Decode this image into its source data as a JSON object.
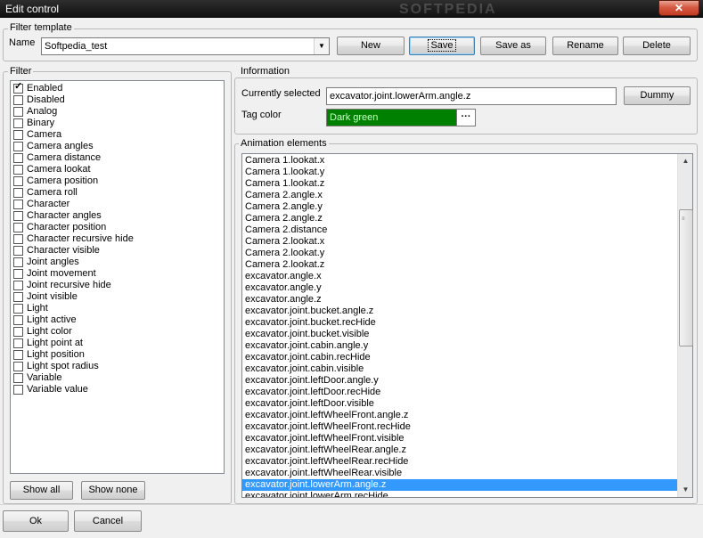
{
  "window": {
    "title": "Edit control",
    "close_glyph": "✕",
    "watermark": "SOFTPEDIA"
  },
  "filter_template": {
    "group_label": "Filter template",
    "name_label": "Name",
    "name_value": "Softpedia_test",
    "buttons": {
      "new": "New",
      "save": "Save",
      "save_as": "Save as",
      "rename": "Rename",
      "delete": "Delete"
    }
  },
  "filter": {
    "group_label": "Filter",
    "items": [
      {
        "label": "Enabled",
        "checked": true
      },
      {
        "label": "Disabled",
        "checked": false
      },
      {
        "label": "Analog",
        "checked": false
      },
      {
        "label": "Binary",
        "checked": false
      },
      {
        "label": "Camera",
        "checked": false
      },
      {
        "label": "Camera angles",
        "checked": false
      },
      {
        "label": "Camera distance",
        "checked": false
      },
      {
        "label": "Camera lookat",
        "checked": false
      },
      {
        "label": "Camera position",
        "checked": false
      },
      {
        "label": "Camera roll",
        "checked": false
      },
      {
        "label": "Character",
        "checked": false
      },
      {
        "label": "Character angles",
        "checked": false
      },
      {
        "label": "Character position",
        "checked": false
      },
      {
        "label": "Character recursive hide",
        "checked": false
      },
      {
        "label": "Character visible",
        "checked": false
      },
      {
        "label": "Joint angles",
        "checked": false
      },
      {
        "label": "Joint movement",
        "checked": false
      },
      {
        "label": "Joint recursive hide",
        "checked": false
      },
      {
        "label": "Joint visible",
        "checked": false
      },
      {
        "label": "Light",
        "checked": false
      },
      {
        "label": "Light active",
        "checked": false
      },
      {
        "label": "Light color",
        "checked": false
      },
      {
        "label": "Light point at",
        "checked": false
      },
      {
        "label": "Light position",
        "checked": false
      },
      {
        "label": "Light spot radius",
        "checked": false
      },
      {
        "label": "Variable",
        "checked": false
      },
      {
        "label": "Variable value",
        "checked": false
      }
    ],
    "show_all": "Show all",
    "show_none": "Show none"
  },
  "information": {
    "group_label": "Information",
    "currently_selected_label": "Currently selected",
    "currently_selected_value": "excavator.joint.lowerArm.angle.z",
    "dummy_button": "Dummy",
    "tag_color_label": "Tag color",
    "tag_color_value": "Dark green",
    "tag_color_hex": "#008000",
    "tag_color_button": "···"
  },
  "animation": {
    "group_label": "Animation elements",
    "items": [
      "Camera 1.lookat.x",
      "Camera 1.lookat.y",
      "Camera 1.lookat.z",
      "Camera 2.angle.x",
      "Camera 2.angle.y",
      "Camera 2.angle.z",
      "Camera 2.distance",
      "Camera 2.lookat.x",
      "Camera 2.lookat.y",
      "Camera 2.lookat.z",
      "excavator.angle.x",
      "excavator.angle.y",
      "excavator.angle.z",
      "excavator.joint.bucket.angle.z",
      "excavator.joint.bucket.recHide",
      "excavator.joint.bucket.visible",
      "excavator.joint.cabin.angle.y",
      "excavator.joint.cabin.recHide",
      "excavator.joint.cabin.visible",
      "excavator.joint.leftDoor.angle.y",
      "excavator.joint.leftDoor.recHide",
      "excavator.joint.leftDoor.visible",
      "excavator.joint.leftWheelFront.angle.z",
      "excavator.joint.leftWheelFront.recHide",
      "excavator.joint.leftWheelFront.visible",
      "excavator.joint.leftWheelRear.angle.z",
      "excavator.joint.leftWheelRear.recHide",
      "excavator.joint.leftWheelRear.visible",
      "excavator.joint.lowerArm.angle.z",
      "excavator.joint.lowerArm.recHide"
    ],
    "selected_index": 28
  },
  "footer": {
    "ok": "Ok",
    "cancel": "Cancel"
  }
}
